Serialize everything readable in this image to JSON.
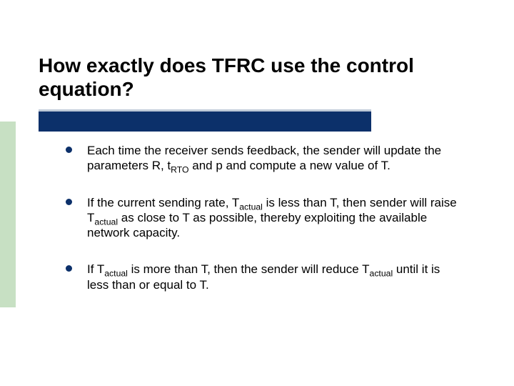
{
  "title": "How exactly does TFRC use the control equation?",
  "bullets": [
    {
      "pre": "Each time the receiver sends feedback, the sender will update the parameters R, t",
      "sub1": "RTO",
      "mid": " and p and compute a new value of T.",
      "sub2": "",
      "mid2": "",
      "sub3": "",
      "tail": ""
    },
    {
      "pre": "If the current sending rate, T",
      "sub1": "actual",
      "mid": " is less than T, then sender will raise T",
      "sub2": "actual",
      "mid2": " as close to T as possible, thereby exploiting the available network capacity.",
      "sub3": "",
      "tail": ""
    },
    {
      "pre": "If T",
      "sub1": "actual",
      "mid": " is more than T, then the sender will reduce T",
      "sub2": "actual",
      "mid2": " until it is less than or equal to T.",
      "sub3": "",
      "tail": ""
    }
  ]
}
